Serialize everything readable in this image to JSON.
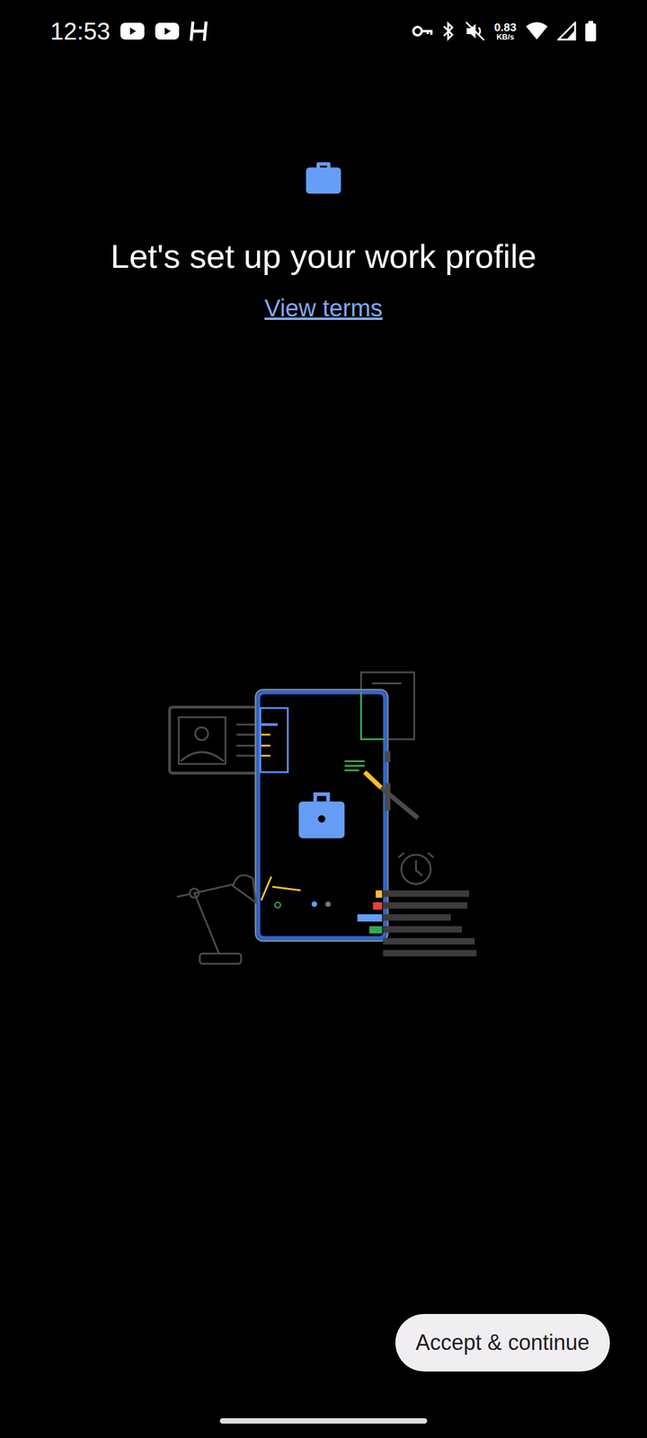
{
  "status_bar": {
    "time": "12:53",
    "speed": "0.83",
    "speed_unit": "KB/s"
  },
  "title": "Let's set up your work profile",
  "link": "View terms",
  "button": "Accept & continue"
}
